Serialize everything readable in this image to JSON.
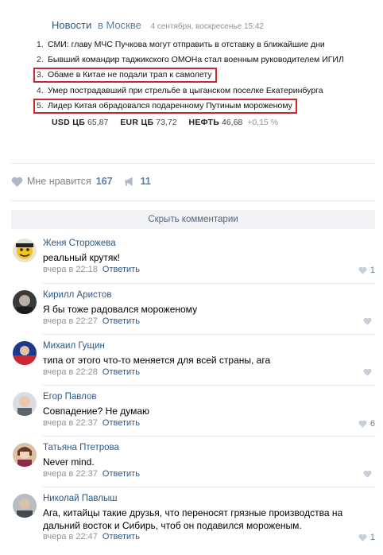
{
  "news": {
    "source": "Новости",
    "location": "в Москве",
    "date": "4 сентября, воскресенье 15:42",
    "items": [
      {
        "num": "1.",
        "text": "СМИ: главу МЧС Пучкова могут отправить в отставку в ближайшие дни"
      },
      {
        "num": "2.",
        "text": "Бывший командир таджикского ОМОНа стал военным руководителем ИГИЛ"
      },
      {
        "num": "3.",
        "text": "Обаме в Китае не подали трап к самолету"
      },
      {
        "num": "4.",
        "text": "Умер пострадавший при стрельбе в цыганском поселке Екатеринбурга"
      },
      {
        "num": "5.",
        "text": "Лидер Китая обрадовался подаренному Путиным мороженому"
      }
    ],
    "rates": {
      "usd_label": "USD ЦБ",
      "usd_value": "65,87",
      "eur_label": "EUR ЦБ",
      "eur_value": "73,72",
      "oil_label": "НЕФТЬ",
      "oil_value": "46,68",
      "oil_change": "+0,15 %"
    }
  },
  "actions": {
    "like_label": "Мне нравится",
    "like_count": "167",
    "share_count": "11"
  },
  "hide_comments_label": "Скрыть комментарии",
  "comments": [
    {
      "name": "Женя Сторожева",
      "text": "реальный крутяк!",
      "time": "вчера в 22:18",
      "reply": "Ответить",
      "likes": "1"
    },
    {
      "name": "Кирилл Аристов",
      "text": "Я бы тоже радовался мороженому",
      "time": "вчера в 22:27",
      "reply": "Ответить",
      "likes": ""
    },
    {
      "name": "Михаил Гущин",
      "text": "типа от этого что-то меняется для всей страны, ага",
      "time": "вчера в 22:28",
      "reply": "Ответить",
      "likes": ""
    },
    {
      "name": "Егор Павлов",
      "text": "Совпадение? Не думаю",
      "time": "вчера в 22:37",
      "reply": "Ответить",
      "likes": "6"
    },
    {
      "name": "Татьяна Птетрова",
      "text": "Never mind.",
      "time": "вчера в 22:37",
      "reply": "Ответить",
      "likes": ""
    },
    {
      "name": "Николай Павлыш",
      "text": "Ага, китайцы такие друзья, что переносят грязные производства на дальний восток и Сибирь, чтоб он подавился мороженым.",
      "time": "вчера в 22:47",
      "reply": "Ответить",
      "likes": "1"
    }
  ],
  "colors": {
    "link": "#2a5885",
    "highlight_border": "#c8282e",
    "muted": "#939393"
  }
}
